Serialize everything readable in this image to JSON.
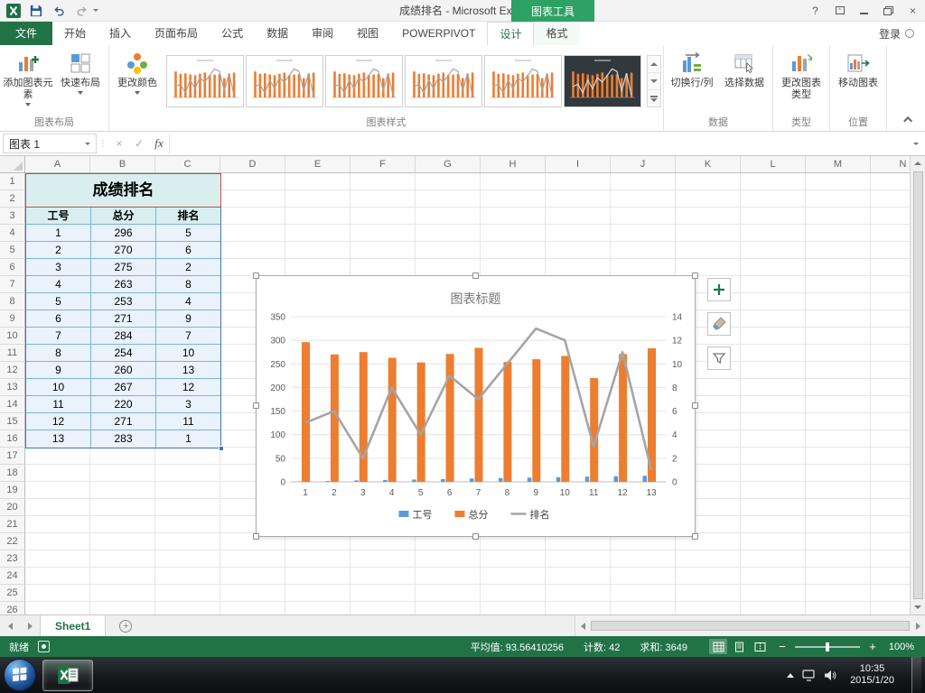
{
  "colors": {
    "excel_green": "#217346",
    "contextual_green": "#2EA264",
    "bar_blue": "#5B9BD5",
    "bar_orange": "#ED7D31",
    "line_gray": "#A5A5A5"
  },
  "titlebar": {
    "title": "成绩排名 - Microsoft Excel",
    "context_tool": "图表工具"
  },
  "ribbon": {
    "file_tab": "文件",
    "tabs": [
      "开始",
      "插入",
      "页面布局",
      "公式",
      "数据",
      "审阅",
      "视图",
      "POWERPIVOT"
    ],
    "contextual_tabs": [
      {
        "label": "设计",
        "active": true
      },
      {
        "label": "格式",
        "active": false
      }
    ],
    "signin": "登录",
    "buttons": {
      "add_chart_element": "添加图表元素",
      "quick_layout": "快速布局",
      "change_colors": "更改颜色",
      "switch_row_col": "切换行/列",
      "select_data": "选择数据",
      "change_chart_type": "更改图表类型",
      "move_chart": "移动图表"
    },
    "group_labels": [
      "图表布局",
      "图表样式",
      "数据",
      "类型",
      "位置"
    ],
    "style_thumbnail_count": 6
  },
  "formula_bar": {
    "name_box": "图表 1",
    "fx_label": "fx",
    "value": ""
  },
  "grid": {
    "columns": [
      "A",
      "B",
      "C",
      "D",
      "E",
      "F",
      "G",
      "H",
      "I",
      "J",
      "K",
      "L",
      "M",
      "N"
    ],
    "visible_rows": 26,
    "table": {
      "title": "成绩排名",
      "headers": [
        "工号",
        "总分",
        "排名"
      ],
      "rows": [
        [
          1,
          296,
          5
        ],
        [
          2,
          270,
          6
        ],
        [
          3,
          275,
          2
        ],
        [
          4,
          263,
          8
        ],
        [
          5,
          253,
          4
        ],
        [
          6,
          271,
          9
        ],
        [
          7,
          284,
          7
        ],
        [
          8,
          254,
          10
        ],
        [
          9,
          260,
          13
        ],
        [
          10,
          267,
          12
        ],
        [
          11,
          220,
          3
        ],
        [
          12,
          271,
          11
        ],
        [
          13,
          283,
          1
        ]
      ]
    }
  },
  "chart_data": {
    "type": "combo",
    "title": "图表标题",
    "categories": [
      "1",
      "2",
      "3",
      "4",
      "5",
      "6",
      "7",
      "8",
      "9",
      "10",
      "11",
      "12",
      "13"
    ],
    "series": [
      {
        "name": "工号",
        "chart": "bar",
        "axis": "left",
        "color": "#5B9BD5",
        "values": [
          1,
          2,
          3,
          4,
          5,
          6,
          7,
          8,
          9,
          10,
          11,
          12,
          13
        ]
      },
      {
        "name": "总分",
        "chart": "bar",
        "axis": "left",
        "color": "#ED7D31",
        "values": [
          296,
          270,
          275,
          263,
          253,
          271,
          284,
          254,
          260,
          267,
          220,
          271,
          283
        ]
      },
      {
        "name": "排名",
        "chart": "line",
        "axis": "right",
        "color": "#A5A5A5",
        "values": [
          5,
          6,
          2,
          8,
          4,
          9,
          7,
          10,
          13,
          12,
          3,
          11,
          1
        ]
      }
    ],
    "left_axis": {
      "min": 0,
      "max": 350,
      "step": 50
    },
    "right_axis": {
      "min": 0,
      "max": 14,
      "step": 2
    },
    "grid": true,
    "legend_position": "bottom"
  },
  "chart_side_buttons": [
    "chart-elements-plus",
    "chart-style-brush",
    "chart-filter-funnel"
  ],
  "sheet_tabs": {
    "active": "Sheet1"
  },
  "status_bar": {
    "mode": "就绪",
    "stats": [
      "平均值: 93.56410256",
      "计数: 42",
      "求和: 3649"
    ],
    "zoom": "100%"
  },
  "taskbar": {
    "time": "10:35",
    "date": "2015/1/20"
  }
}
